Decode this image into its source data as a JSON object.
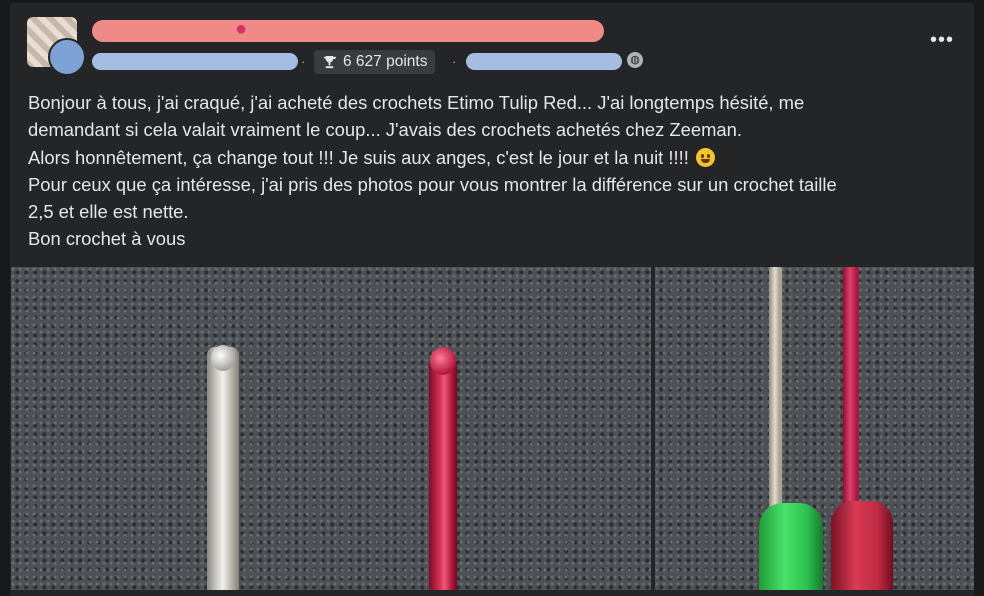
{
  "post": {
    "author_name": "",
    "points": "6 627 points",
    "more_label": "•••",
    "body_lines": [
      "Bonjour à tous, j'ai craqué, j'ai acheté des crochets Etimo Tulip Red... J'ai longtemps hésité,  me",
      "demandant si cela valait vraiment le coup... J'avais des crochets achetés chez Zeeman.",
      "Alors honnêtement, ça change tout !!! Je suis aux anges, c'est le jour et la nuit !!!!",
      "Pour ceux que ça intéresse, j'ai pris des photos pour vous montrer la différence sur un crochet taille",
      "2,5 et elle est nette.",
      "Bon crochet à vous"
    ]
  },
  "icons": {
    "trophy": "trophy-icon",
    "globe": "globe-icon",
    "more": "more-options-icon",
    "emoji": "grinning-face-emoji"
  },
  "colors": {
    "background": "#18191a",
    "card": "#242526",
    "text": "#e4e6eb",
    "redaction_name": "#f08a86",
    "redaction_meta": "#a6bde3"
  }
}
